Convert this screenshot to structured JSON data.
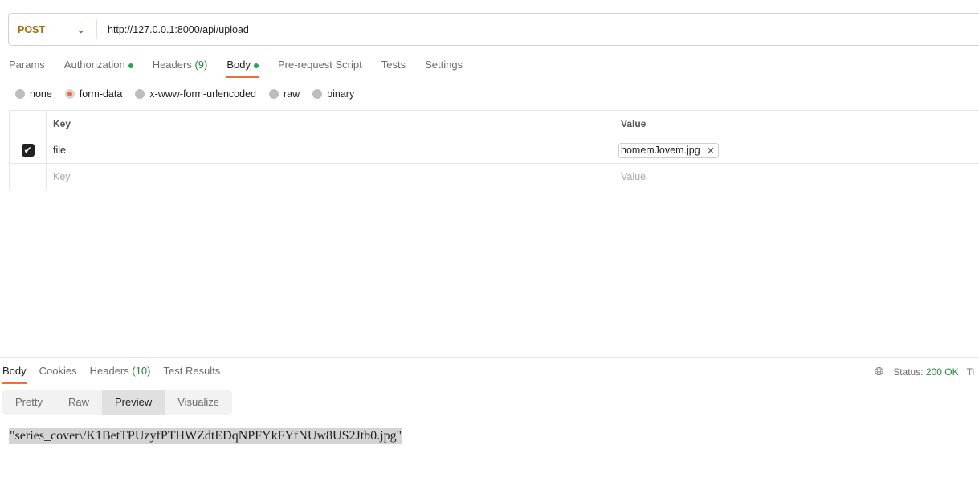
{
  "request": {
    "method": "POST",
    "url": "http://127.0.0.1:8000/api/upload"
  },
  "tabs": [
    {
      "label": "Params"
    },
    {
      "label": "Authorization"
    },
    {
      "label": "Headers",
      "count": "(9)"
    },
    {
      "label": "Body"
    },
    {
      "label": "Pre-request Script"
    },
    {
      "label": "Tests"
    },
    {
      "label": "Settings"
    }
  ],
  "body_modes": [
    "none",
    "form-data",
    "x-www-form-urlencoded",
    "raw",
    "binary"
  ],
  "selected_mode": "form-data",
  "table": {
    "key_header": "Key",
    "value_header": "Value",
    "rows": [
      {
        "key": "file",
        "value": "homemJovem.jpg",
        "checked": true
      }
    ],
    "key_placeholder": "Key",
    "value_placeholder": "Value"
  },
  "response": {
    "tabs": [
      {
        "label": "Body"
      },
      {
        "label": "Cookies"
      },
      {
        "label": "Headers",
        "count": "(10)"
      },
      {
        "label": "Test Results"
      }
    ],
    "status_label": "Status:",
    "status_value": "200 OK",
    "time_label": "Ti",
    "views": [
      "Pretty",
      "Raw",
      "Preview",
      "Visualize"
    ],
    "active_view": "Preview",
    "output": "\"series_cover\\/K1BetTPUzyfPTHWZdtEDqNPFYkFYfNUw8US2Jtb0.jpg\""
  },
  "colors": {
    "accent": "#f26b3a",
    "method": "#a8690c",
    "success": "#26853b"
  }
}
